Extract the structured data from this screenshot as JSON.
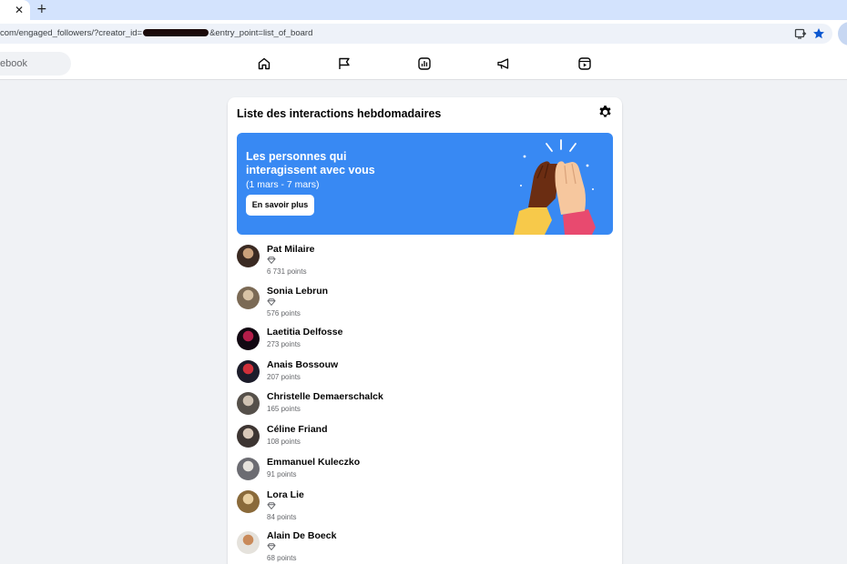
{
  "browser": {
    "tab_close_glyph": "✕",
    "new_tab_glyph": "+",
    "url_prefix": "com/engaged_followers/?creator_id=",
    "url_suffix": "&entry_point=list_of_board"
  },
  "fb_nav": {
    "search_text": "ebook",
    "icons": [
      "home-icon",
      "flag-icon",
      "insights-icon",
      "megaphone-icon",
      "reels-icon"
    ]
  },
  "card": {
    "title": "Liste des interactions hebdomadaires",
    "banner": {
      "title": "Les personnes qui interagissent avec vous",
      "date_range": "(1 mars - 7 mars)",
      "button_label": "En savoir plus",
      "accent_color": "#3889f3"
    },
    "people": [
      {
        "name": "Pat Milaire",
        "badge": true,
        "points": "6 731 points"
      },
      {
        "name": "Sonia Lebrun",
        "badge": true,
        "points": "576 points"
      },
      {
        "name": "Laetitia Delfosse",
        "badge": false,
        "points": "273 points"
      },
      {
        "name": "Anais Bossouw",
        "badge": false,
        "points": "207 points"
      },
      {
        "name": "Christelle Demaerschalck",
        "badge": false,
        "points": "165 points"
      },
      {
        "name": "Céline Friand",
        "badge": false,
        "points": "108 points"
      },
      {
        "name": "Emmanuel Kuleczko",
        "badge": false,
        "points": "91 points"
      },
      {
        "name": "Lora Lie",
        "badge": true,
        "points": "84 points"
      },
      {
        "name": "Alain De Boeck",
        "badge": true,
        "points": "68 points"
      }
    ]
  }
}
